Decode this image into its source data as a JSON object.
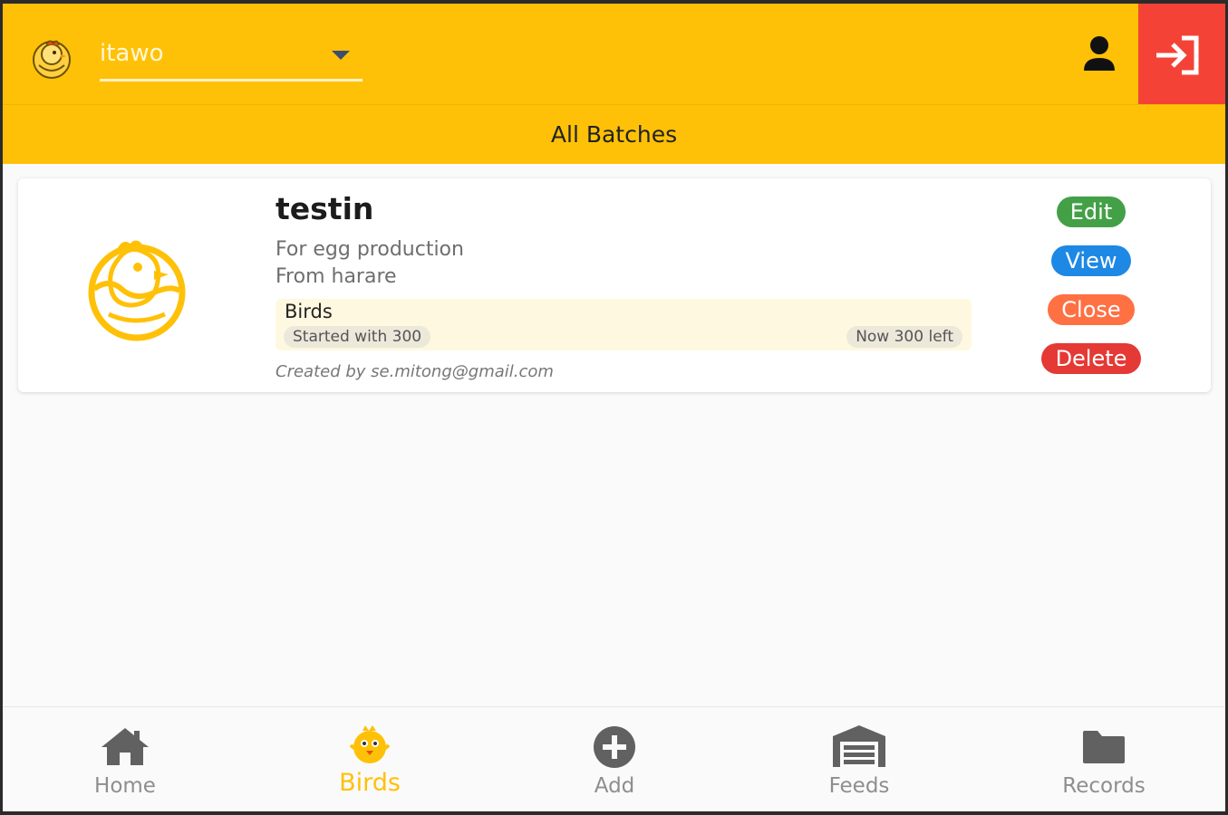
{
  "header": {
    "farm_select": {
      "value": "itawo"
    },
    "title": "All Batches"
  },
  "batch": {
    "name": "testin",
    "purpose": "For egg production",
    "origin": "From harare",
    "birds_label": "Birds",
    "started_with": "Started with 300",
    "now_left": "Now 300 left",
    "created_by": "Created by se.mitong@gmail.com"
  },
  "actions": {
    "edit": "Edit",
    "view": "View",
    "close": "Close",
    "delete": "Delete"
  },
  "nav": {
    "items": [
      {
        "label": "Home",
        "icon": "home-icon"
      },
      {
        "label": "Birds",
        "icon": "chick-icon",
        "active": true
      },
      {
        "label": "Add",
        "icon": "add-circle-icon"
      },
      {
        "label": "Feeds",
        "icon": "warehouse-icon"
      },
      {
        "label": "Records",
        "icon": "folder-icon"
      }
    ]
  },
  "colors": {
    "primary": "#ffc107",
    "logout": "#f44336",
    "edit": "#43a047",
    "view": "#1e88e5",
    "close": "#ff7043",
    "delete": "#e53935"
  }
}
